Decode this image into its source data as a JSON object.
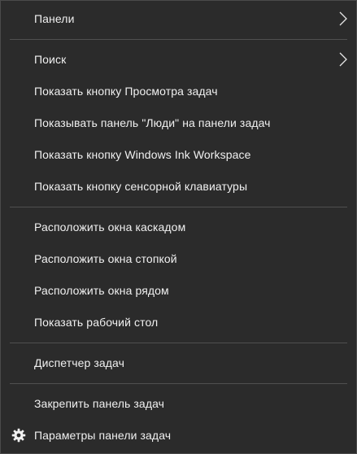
{
  "menu": {
    "items": [
      {
        "label": "Панели",
        "submenu": true
      },
      {
        "label": "Поиск",
        "submenu": true
      },
      {
        "label": "Показать кнопку Просмотра задач"
      },
      {
        "label": "Показывать панель \"Люди\" на панели задач"
      },
      {
        "label": "Показать кнопку Windows Ink Workspace"
      },
      {
        "label": "Показать кнопку сенсорной клавиатуры"
      },
      {
        "label": "Расположить окна каскадом"
      },
      {
        "label": "Расположить окна стопкой"
      },
      {
        "label": "Расположить окна рядом"
      },
      {
        "label": "Показать рабочий стол"
      },
      {
        "label": "Диспетчер задач"
      },
      {
        "label": "Закрепить панель задач"
      },
      {
        "label": "Параметры панели задач",
        "icon": "gear-icon"
      }
    ]
  },
  "colors": {
    "background": "#2b2b2b",
    "text": "#f0f0f0",
    "separator": "#505050"
  }
}
